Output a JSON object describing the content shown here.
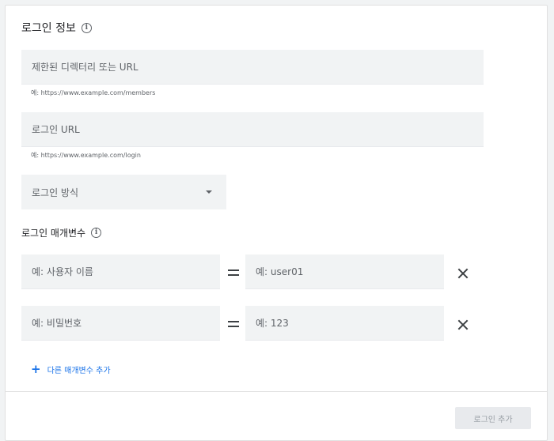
{
  "login_info": {
    "title": "로그인 정보",
    "info_glyph": "i",
    "restricted_dir": {
      "placeholder": "제한된 디렉터리 또는 URL",
      "hint": "예: https://www.example.com/members"
    },
    "login_url": {
      "placeholder": "로그인 URL",
      "hint": "예: https://www.example.com/login"
    },
    "login_method": {
      "label": "로그인 방식"
    }
  },
  "params": {
    "title": "로그인 매개변수",
    "info_glyph": "i",
    "rows": [
      {
        "name_placeholder": "예: 사용자 이름",
        "value_placeholder": "예: user01"
      },
      {
        "name_placeholder": "예: 비밀번호",
        "value_placeholder": "예: 123"
      }
    ],
    "add_icon": "+",
    "add_label": "다른 매개변수 추가"
  },
  "footer": {
    "submit_label": "로그인 추가",
    "submit_disabled": true
  }
}
